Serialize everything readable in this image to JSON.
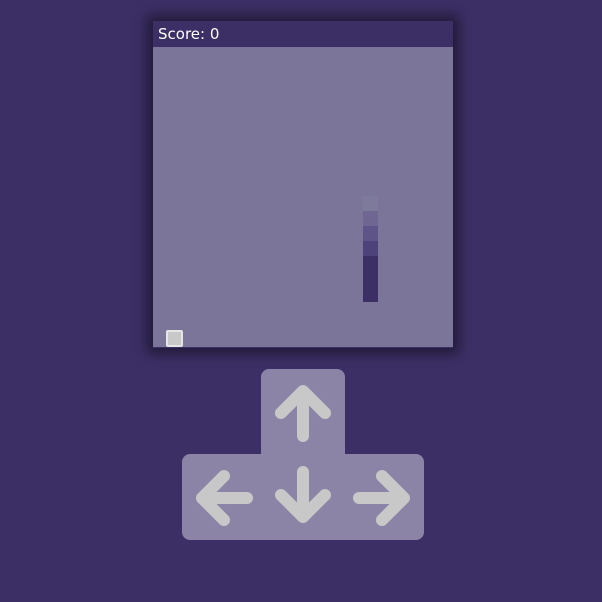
{
  "game": {
    "score_label": "Score: 0",
    "colors": {
      "background": "#3c2f66",
      "board": "#7b7699",
      "snake_head": "#3c2f66",
      "food": "#c8c8c8",
      "control_pad": "#8c84a6",
      "arrow": "#c8c8c8"
    },
    "controls": {
      "up": "arrow-up-icon",
      "left": "arrow-left-icon",
      "down": "arrow-down-icon",
      "right": "arrow-right-icon"
    }
  }
}
